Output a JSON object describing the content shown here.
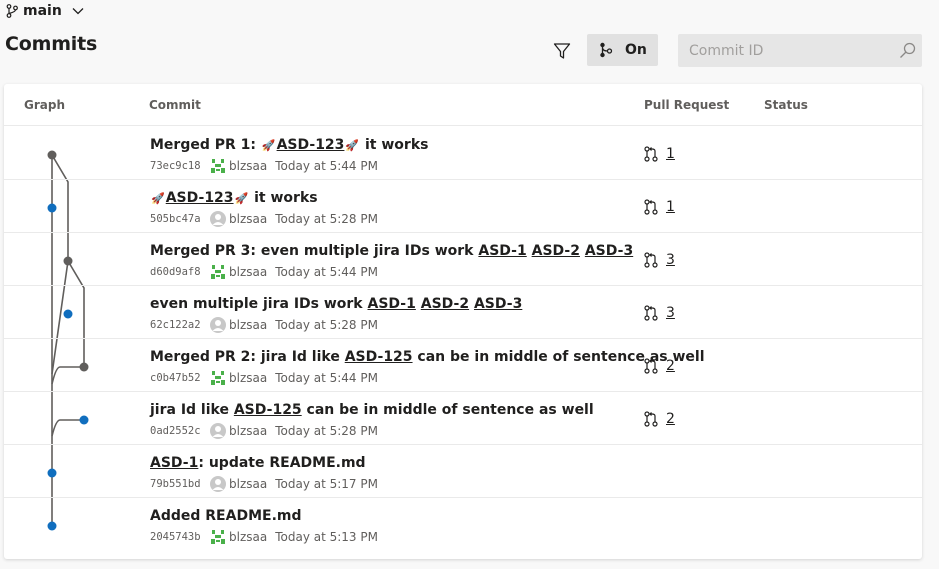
{
  "branch": {
    "name": "main",
    "icon": "branch-icon"
  },
  "page": {
    "title": "Commits"
  },
  "toolbar": {
    "filter_icon": "filter-icon",
    "graph_toggle_label": "On",
    "graph_toggle_icon": "graph-icon",
    "search_placeholder": "Commit ID",
    "search_value": "",
    "search_icon": "search-icon"
  },
  "table": {
    "columns": [
      "Graph",
      "Commit",
      "Pull Request",
      "Status"
    ],
    "rows": [
      {
        "parts": {
          "pre": "Merged PR 1: ",
          "rocket1": "🚀",
          "jira": "ASD-123",
          "rocket2": "🚀",
          "suffix": " it works"
        },
        "id": "73ec9c18",
        "avatar": "generated",
        "author": "blzsaa",
        "time": "Today at 5:44 PM",
        "pr": "1",
        "node": "merge"
      },
      {
        "parts": {
          "pre": "",
          "rocket1": "🚀",
          "jira": "ASD-123",
          "rocket2": "🚀",
          "suffix": " it works"
        },
        "id": "505bc47a",
        "avatar": "default",
        "author": "blzsaa",
        "time": "Today at 5:28 PM",
        "pr": "1",
        "node": "commit"
      },
      {
        "parts": {
          "pre": "Merged PR 3: even multiple jira IDs work ",
          "j1": "ASD-1",
          "j2": "ASD-2",
          "j3": "ASD-3"
        },
        "id": "d60d9af8",
        "avatar": "generated",
        "author": "blzsaa",
        "time": "Today at 5:44 PM",
        "pr": "3",
        "node": "merge"
      },
      {
        "parts": {
          "pre": "even multiple jira IDs work ",
          "j1": "ASD-1",
          "j2": "ASD-2",
          "j3": "ASD-3"
        },
        "id": "62c122a2",
        "avatar": "default",
        "author": "blzsaa",
        "time": "Today at 5:28 PM",
        "pr": "3",
        "node": "commit"
      },
      {
        "parts": {
          "pre": "Merged PR 2: jira Id like ",
          "jira": "ASD-125",
          "suffix": " can be in middle of sentence as well"
        },
        "id": "c0b47b52",
        "avatar": "generated",
        "author": "blzsaa",
        "time": "Today at 5:44 PM",
        "pr": "2",
        "node": "merge"
      },
      {
        "parts": {
          "pre": "jira Id like ",
          "jira": "ASD-125",
          "suffix": " can be in middle of sentence as well"
        },
        "id": "0ad2552c",
        "avatar": "default",
        "author": "blzsaa",
        "time": "Today at 5:28 PM",
        "pr": "2",
        "node": "commit"
      },
      {
        "parts": {
          "pre": "",
          "jira": "ASD-1",
          "suffix": ": update README.md"
        },
        "id": "79b551bd",
        "avatar": "default",
        "author": "blzsaa",
        "time": "Today at 5:17 PM",
        "pr": "",
        "node": "commit"
      },
      {
        "parts": {
          "pre": "Added README.md"
        },
        "id": "2045743b",
        "avatar": "generated",
        "author": "blzsaa",
        "time": "Today at 5:13 PM",
        "pr": "",
        "node": "commit"
      }
    ]
  },
  "colors": {
    "merge_node": "#605e5c",
    "commit_node": "#106ebe",
    "graph_line": "#605e5c",
    "identicon": "#4ab04a"
  }
}
